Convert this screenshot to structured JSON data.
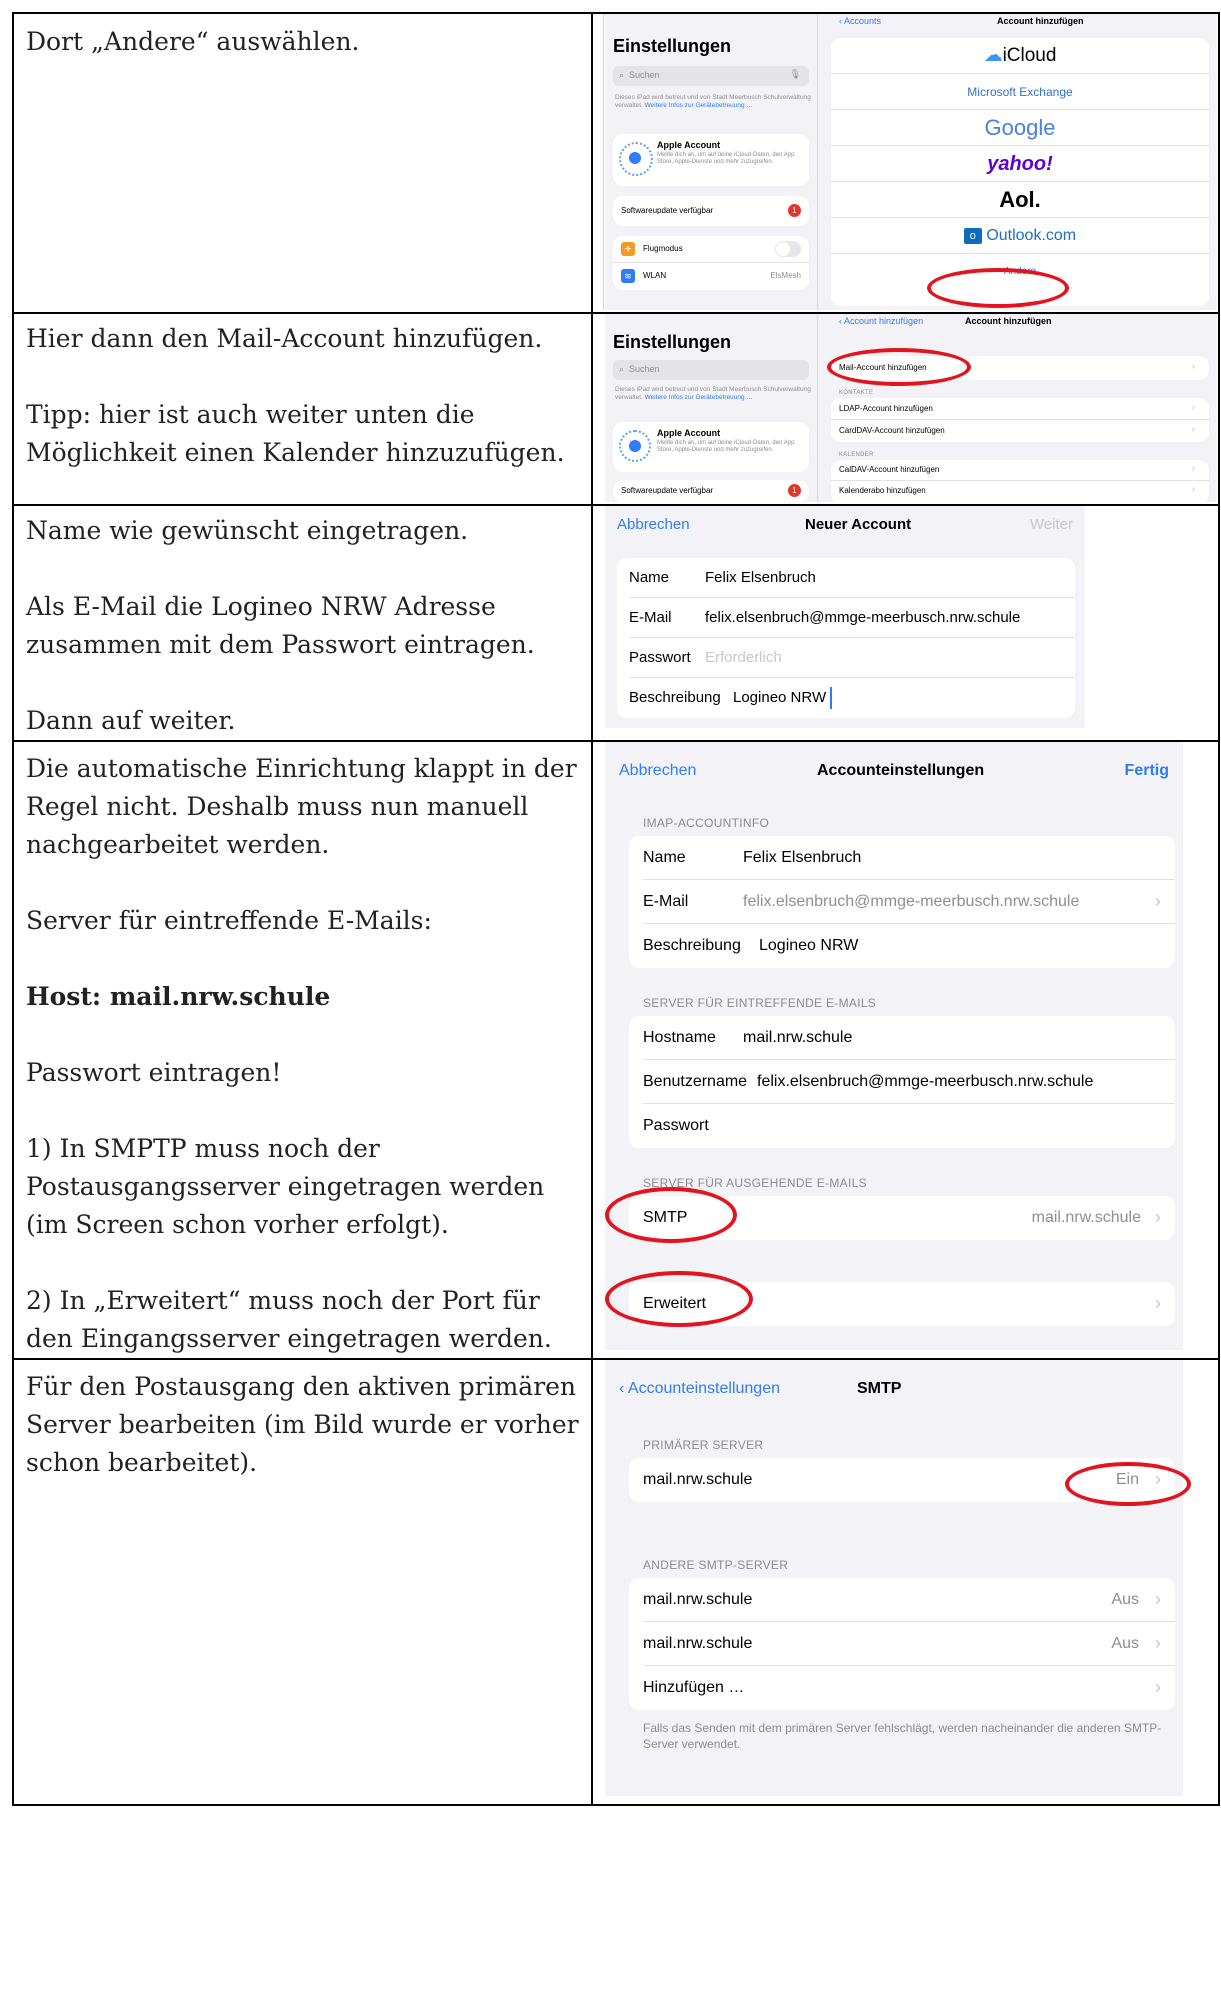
{
  "rows": [
    {
      "text": [
        "Dort „Andere“ auswählen."
      ]
    },
    {
      "text": [
        "Hier dann den Mail-Account hinzufügen.",
        "",
        "Tipp: hier ist auch weiter unten die Möglichkeit einen Kalender hinzuzufügen."
      ]
    },
    {
      "text": [
        "Name wie gewünscht eingetragen.",
        "",
        "Als E-Mail die Logineo NRW Adresse zusammen mit dem Passwort eintragen.",
        "",
        "Dann auf weiter."
      ]
    },
    {
      "text": [
        "Die automatische Einrichtung klappt in der Regel nicht. Deshalb muss nun manuell nachgearbeitet werden.",
        "",
        "Server für eintreffende E-Mails:",
        "",
        "Host: mail.nrw.schule",
        "",
        "Passwort eintragen!",
        "",
        "1) In SMPTP muss noch der Postausgangsserver eingetragen werden (im Screen schon vorher erfolgt).",
        "",
        "2) In „Erweitert“ muss noch der Port für den Eingangsserver eingetragen werden."
      ]
    },
    {
      "text": [
        "Für den Postausgang den aktiven primären Server bearbeiten (im Bild wurde er vorher schon bearbeitet)."
      ]
    }
  ],
  "shot1": {
    "sidebar_title": "Einstellungen",
    "search": "Suchen",
    "managed_note": "Dieses iPad wird betreut und von Stadt Meerbusch Schulverwaltung verwaltet.",
    "managed_link": "Weitere Infos zur Gerätebetreuung …",
    "apple_account": "Apple Account",
    "apple_desc": "Melde dich an, um auf deine iCloud-Daten, den App Store, Apple-Dienste und mehr zuzugreifen.",
    "software_update": "Softwareupdate verfügbar",
    "badge": "1",
    "airplane": "Flugmodus",
    "wlan": "WLAN",
    "wlan_value": "ElsMesh",
    "back": "Accounts",
    "title": "Account hinzufügen",
    "providers": [
      "iCloud",
      "Microsoft Exchange",
      "Google",
      "yahoo!",
      "Aol.",
      "Outlook.com",
      "Andere"
    ]
  },
  "shot2": {
    "sidebar_title": "Einstellungen",
    "search": "Suchen",
    "managed_note": "Dieses iPad wird betreut und von Stadt Meerbusch Schulverwaltung verwaltet.",
    "managed_link": "Weitere Infos zur Gerätebetreuung …",
    "apple_account": "Apple Account",
    "apple_desc": "Melde dich an, um auf deine iCloud-Daten, den App Store, Apple-Dienste und mehr zuzugreifen.",
    "software_update": "Softwareupdate verfügbar",
    "badge": "1",
    "back": "Account hinzufügen",
    "title": "Account hinzufügen",
    "mail_row": "Mail-Account hinzufügen",
    "contacts_header": "KONTAKTE",
    "ldap": "LDAP-Account hinzufügen",
    "carddav": "CardDAV-Account hinzufügen",
    "calendar_header": "KALENDER",
    "caldav": "CalDAV-Account hinzufügen",
    "calsub": "Kalenderabo hinzufügen"
  },
  "shot3": {
    "cancel": "Abbrechen",
    "title": "Neuer Account",
    "next": "Weiter",
    "fields": [
      {
        "label": "Name",
        "value": "Felix Elsenbruch",
        "placeholder": ""
      },
      {
        "label": "E-Mail",
        "value": "felix.elsenbruch@mmge-meerbusch.nrw.schule",
        "placeholder": ""
      },
      {
        "label": "Passwort",
        "value": "",
        "placeholder": "Erforderlich"
      },
      {
        "label": "Beschreibung",
        "value": "Logineo NRW",
        "placeholder": ""
      }
    ]
  },
  "shot4": {
    "cancel": "Abbrechen",
    "title": "Accounteinstellungen",
    "done": "Fertig",
    "imap_header": "IMAP-ACCOUNTINFO",
    "name_label": "Name",
    "name_value": "Felix Elsenbruch",
    "email_label": "E-Mail",
    "email_value": "felix.elsenbruch@mmge-meerbusch.nrw.schule",
    "desc_label": "Beschreibung",
    "desc_value": "Logineo NRW",
    "incoming_header": "SERVER FÜR EINTREFFENDE E-MAILS",
    "host_label": "Hostname",
    "host_value": "mail.nrw.schule",
    "user_label": "Benutzername",
    "user_value": "felix.elsenbruch@mmge-meerbusch.nrw.schule",
    "pass_label": "Passwort",
    "outgoing_header": "SERVER FÜR AUSGEHENDE E-MAILS",
    "smtp_label": "SMTP",
    "smtp_value": "mail.nrw.schule",
    "advanced_label": "Erweitert"
  },
  "shot5": {
    "back": "Accounteinstellungen",
    "title": "SMTP",
    "primary_header": "PRIMÄRER SERVER",
    "primary_server": "mail.nrw.schule",
    "primary_status": "Ein",
    "other_header": "ANDERE SMTP-SERVER",
    "other_servers": [
      {
        "name": "mail.nrw.schule",
        "status": "Aus"
      },
      {
        "name": "mail.nrw.schule",
        "status": "Aus"
      }
    ],
    "add": "Hinzufügen …",
    "footer": "Falls das Senden mit dem primären Server fehlschlägt, werden nacheinander die anderen SMTP-Server verwendet."
  }
}
